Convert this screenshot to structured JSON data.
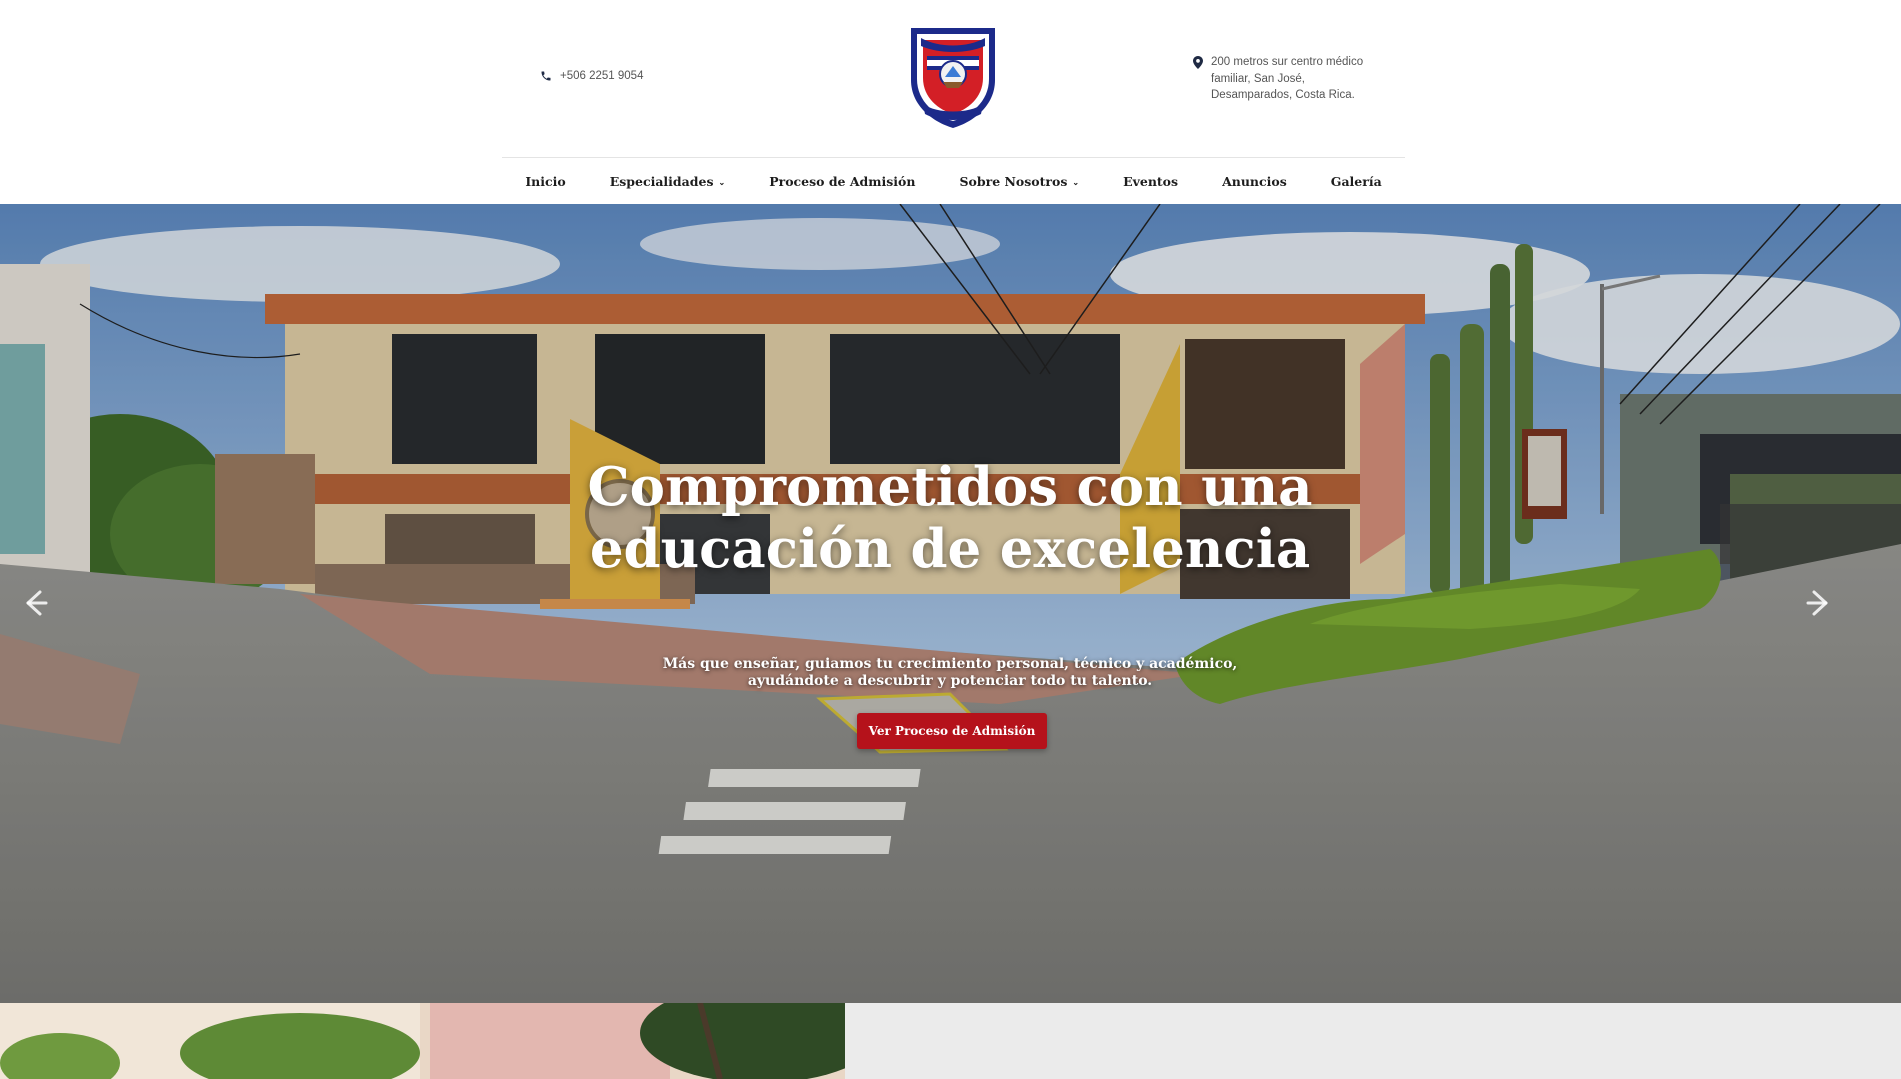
{
  "header": {
    "phone": "+506 2251 9054",
    "address": "200 metros sur centro médico familiar, San José, Desamparados, Costa Rica.",
    "logo_icon": "school-crest-icon",
    "phone_icon": "phone-icon",
    "address_icon": "map-pin-icon"
  },
  "nav": {
    "items": [
      {
        "label": "Inicio"
      },
      {
        "label": "Especialidades",
        "chevron": "⌄"
      },
      {
        "label": "Proceso de Admisión"
      },
      {
        "label": "Sobre Nosotros",
        "chevron": "⌄"
      },
      {
        "label": "Eventos"
      },
      {
        "label": "Anuncios"
      },
      {
        "label": "Galería"
      }
    ]
  },
  "hero": {
    "title": "Comprometidos con una educación de excelencia",
    "subtitle": "Más que enseñar, guiamos tu crecimiento personal, técnico y académico, ayudándote a descubrir y potenciar todo tu talento.",
    "cta_label": "Ver Proceso de Admisión",
    "prev_icon": "arrow-left-icon",
    "next_icon": "arrow-right-icon"
  },
  "colors": {
    "accent": "#b5121b",
    "nav_text": "#1d1d1d",
    "panel_bg": "#ebebeb"
  }
}
